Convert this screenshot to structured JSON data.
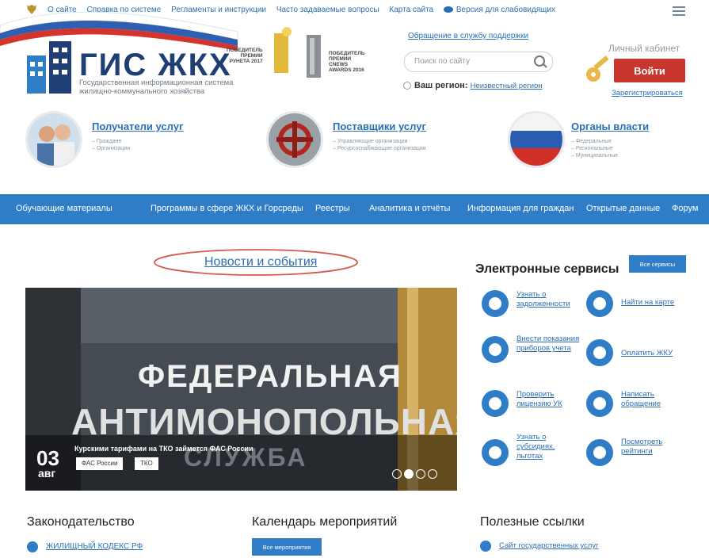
{
  "topbar": {
    "items": [
      "О сайте",
      "Справка по системе",
      "Регламенты и инструкции",
      "Часто задаваемые вопросы",
      "Карта сайта"
    ],
    "accessibility": "Версия для слабовидящих"
  },
  "header": {
    "logo": "ГИС ЖКХ",
    "subtitle1": "Государственная информационная система",
    "subtitle2": "жилищно-коммунального хозяйства",
    "award1": [
      "ПОБЕДИТЕЛЬ",
      "ПРЕМИИ",
      "РУНЕТА 2017"
    ],
    "award2": [
      "ПОБЕДИТЕЛЬ",
      "ПРЕМИИ",
      "CNEWS",
      "AWARDS 2016"
    ],
    "support_link": "Обращение в службу поддержки",
    "search_placeholder": "Поиск по сайту",
    "region_label": "Ваш регион:",
    "region_value": "Неизвестный регион",
    "cabinet": "Личный кабинет",
    "login": "Войти",
    "register": "Зарегистрироваться"
  },
  "categories": [
    {
      "title": "Получатели услуг",
      "subs": [
        "– Граждане",
        "– Организации"
      ]
    },
    {
      "title": "Поставщики услуг",
      "subs": [
        "– Управляющие организации",
        "– Ресурсоснабжающие организации"
      ]
    },
    {
      "title": "Органы власти",
      "subs": [
        "– Федеральные",
        "– Региональные",
        "– Муниципальные"
      ]
    }
  ],
  "nav": [
    "Обучающие материалы",
    "Программы в сфере ЖКХ и Горсреды",
    "Реестры",
    "Аналитика и отчёты",
    "Информация для граждан",
    "Открытые данные",
    "Форум"
  ],
  "news": {
    "title": "Новости и события",
    "slide_text1": "ФЕДЕРАЛЬНАЯ",
    "slide_text2": "АНТИМОНОПОЛЬНАЯ",
    "slide_text3": "СЛУЖБА",
    "day": "03",
    "month": "авг",
    "headline": "Курскими тарифами на ТКО займется ФАС России",
    "tags": [
      "ФАС России",
      "ТКО"
    ],
    "slide_count": 4,
    "active_slide": 2
  },
  "services": {
    "title": "Электронные сервисы",
    "all_button": "Все сервисы",
    "items": [
      "Узнать о задолженности",
      "Найти на карте",
      "Внести показания приборов учета",
      "Оплатить ЖКУ",
      "Проверить лицензию УК",
      "Написать обращение",
      "Узнать о субсидиях, льготах",
      "Посмотреть рейтинги"
    ]
  },
  "bottom": {
    "law_title": "Законодательство",
    "law_link": "ЖИЛИЩНЫЙ КОДЕКС РФ",
    "calendar_title": "Календарь мероприятий",
    "calendar_button": "Все мероприятия",
    "useful_title": "Полезные ссылки",
    "useful_link": "Сайт государственных услуг"
  },
  "colors": {
    "accent": "#2e7dc6",
    "brand": "#1f3e73",
    "login": "#c8362e"
  }
}
